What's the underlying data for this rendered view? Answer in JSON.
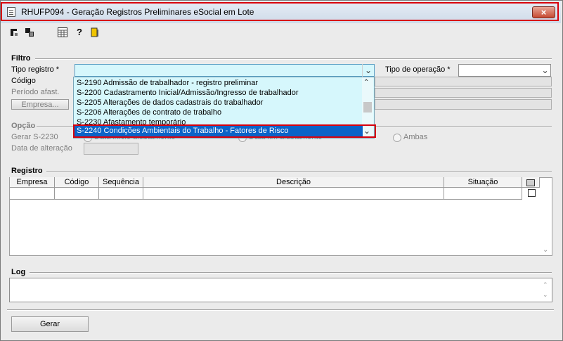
{
  "window": {
    "title": "RHUFP094 - Geração Registros Preliminares eSocial em Lote",
    "close_icon": "×"
  },
  "toolbar": {
    "icons": [
      "first-record-icon",
      "navigate-icon",
      "calculator-icon",
      "help-icon",
      "exit-door-icon"
    ]
  },
  "filtro": {
    "title": "Filtro",
    "tipo_registro_label": "Tipo registro *",
    "tipo_registro_value": "",
    "tipo_operacao_label": "Tipo de operação *",
    "tipo_operacao_value": "",
    "codigo_label": "Código",
    "periodo_label": "Período afast.",
    "empresa_button": "Empresa..."
  },
  "dropdown": {
    "items": [
      "S-2190 Admissão de trabalhador - registro preliminar",
      "S-2200 Cadastramento Inicial/Admissão/Ingresso de trabalhador",
      "S-2205 Alterações de dados cadastrais do trabalhador",
      "S-2206 Alterações de contrato de trabalho",
      "S-2230 Afastamento temporário",
      "S-2240 Condições Ambientais do Trabalho - Fatores de Risco"
    ],
    "selected_index": 5
  },
  "opcao": {
    "title": "Opção",
    "gerar_label": "Gerar S-2230",
    "radio_1": "Data início afastamento",
    "radio_2": "Data fim afastamento",
    "radio_3": "Ambas",
    "data_alteracao_label": "Data de alteração"
  },
  "registro": {
    "title": "Registro",
    "columns": [
      "Empresa",
      "Código",
      "Sequência",
      "Descrição",
      "Situação"
    ]
  },
  "log": {
    "title": "Log"
  },
  "footer": {
    "gerar_button": "Gerar"
  },
  "colors": {
    "highlight_outline": "#d8000c",
    "dropdown_bg": "#d6f7fc",
    "selection_bg": "#0a63c8"
  }
}
